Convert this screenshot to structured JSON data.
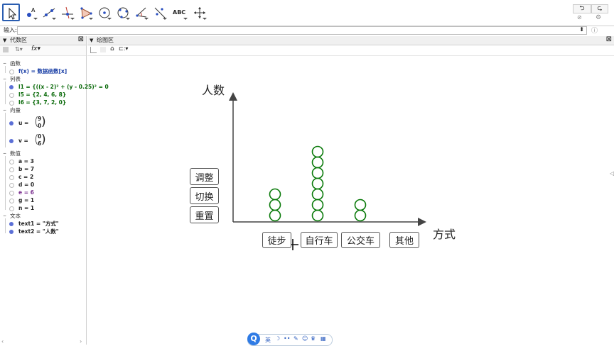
{
  "toolbar": {
    "tools": [
      "move-tool",
      "point-tool",
      "line-tool",
      "perpendicular-tool",
      "polygon-tool",
      "circle-tool",
      "circle-three-points-tool",
      "angle-tool",
      "reflect-tool",
      "text-tool",
      "move-view-tool"
    ],
    "text_tool_label": "ABC"
  },
  "input": {
    "label": "输入:"
  },
  "algebra": {
    "title": "代数区",
    "groups": [
      {
        "name": "函数",
        "items": [
          {
            "text": "f(x) = 数据函数[x]",
            "on": false,
            "color": "#1a3fa6"
          }
        ]
      },
      {
        "name": "列表",
        "items": [
          {
            "text": "l1 = {((x - 2)² + (y - 0.25)² = 0",
            "on": true,
            "color": "#0a6a0a"
          },
          {
            "text": "l5 = {2, 4, 6, 8}",
            "on": false,
            "color": "#0a6a0a"
          },
          {
            "text": "l6 = {3, 7, 2, 0}",
            "on": false,
            "color": "#0a6a0a"
          }
        ]
      },
      {
        "name": "向量",
        "items": [
          {
            "name": "u",
            "top": "9",
            "bottom": "0",
            "on": true
          },
          {
            "name": "v",
            "top": "0",
            "bottom": "6",
            "on": true
          }
        ]
      },
      {
        "name": "数值",
        "items": [
          {
            "text": "a = 3",
            "on": false,
            "color": "#222"
          },
          {
            "text": "b = 7",
            "on": false,
            "color": "#222"
          },
          {
            "text": "c = 2",
            "on": false,
            "color": "#222"
          },
          {
            "text": "d = 0",
            "on": false,
            "color": "#222"
          },
          {
            "text": "e = 6",
            "on": false,
            "color": "#7a2f8f"
          },
          {
            "text": "g = 1",
            "on": false,
            "color": "#222"
          },
          {
            "text": "n = 1",
            "on": false,
            "color": "#222"
          }
        ]
      },
      {
        "name": "文本",
        "items": [
          {
            "text": "text1 = \"方式\"",
            "on": true,
            "color": "#222"
          },
          {
            "text": "text2 = \"人数\"",
            "on": true,
            "color": "#222"
          }
        ]
      }
    ]
  },
  "graphics": {
    "title": "绘图区",
    "y_label": "人数",
    "x_label": "方式",
    "buttons": {
      "adjust": "调整",
      "switch": "切换",
      "reset": "重置"
    },
    "categories": [
      "徒步",
      "自行车",
      "公交车",
      "其他"
    ],
    "counts": [
      3,
      7,
      2,
      0
    ],
    "circle_color": "#0a7a0a"
  },
  "bottom_toolbar": {
    "lang": "英"
  }
}
